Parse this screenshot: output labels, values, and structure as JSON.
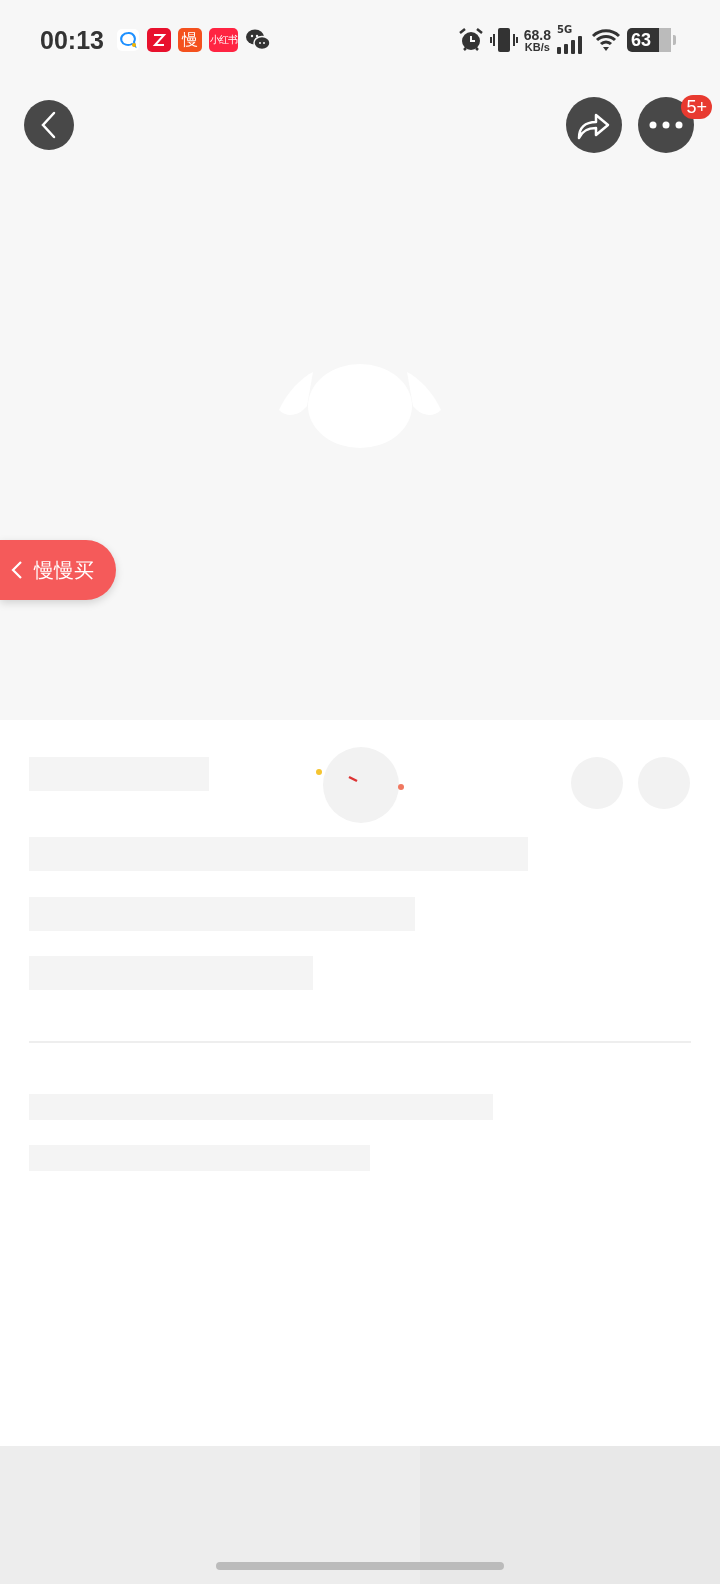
{
  "status_bar": {
    "time": "00:13",
    "notifications": [
      {
        "kind": "chat"
      },
      {
        "kind": "zhihu"
      },
      {
        "kind": "text",
        "label": "慢",
        "color": "#f4511e"
      },
      {
        "kind": "text",
        "label": "小红书",
        "color": "#ff2442"
      },
      {
        "kind": "wechat"
      }
    ],
    "speed_value": "68.8",
    "speed_unit": "KB/s",
    "network": "5G",
    "battery": "63"
  },
  "top_bar": {
    "more_badge": "5+"
  },
  "float_button": {
    "label": "慢慢买"
  }
}
